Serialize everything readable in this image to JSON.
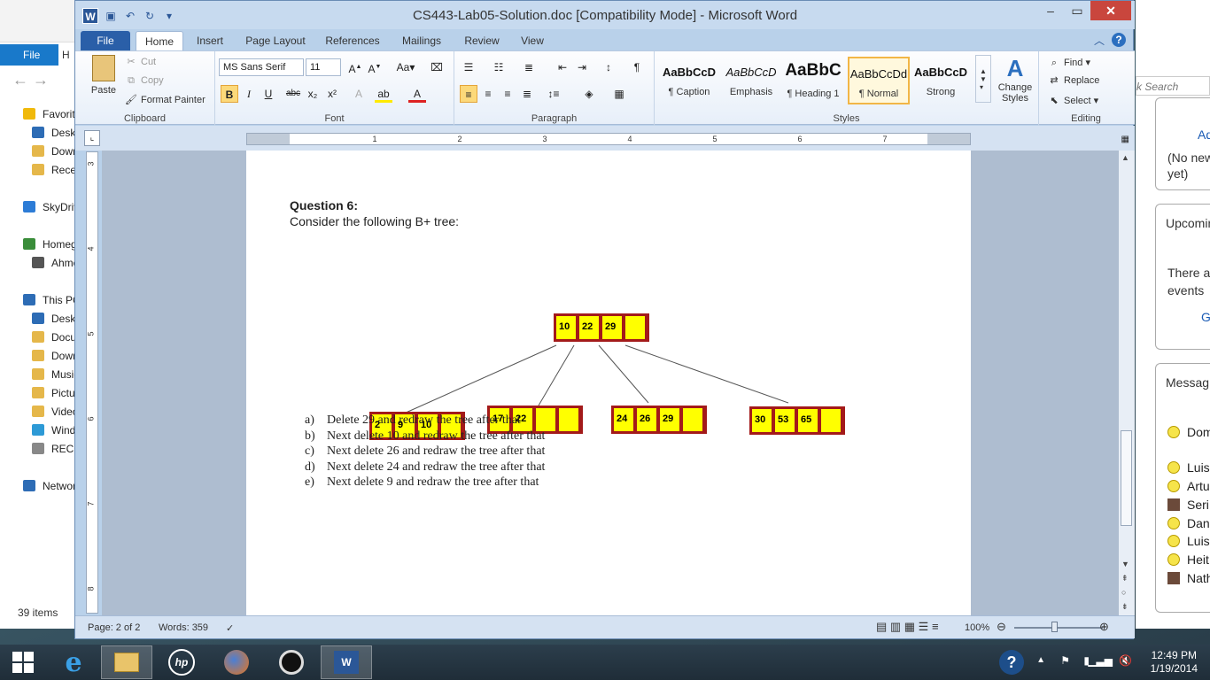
{
  "explorer": {
    "tabs": {
      "file": "File",
      "home_partial": "H"
    },
    "tree": [
      {
        "label": "Favorites",
        "color": "#f0b90b"
      },
      {
        "label": "Desktop",
        "color": "#2d6cb5"
      },
      {
        "label": "Downloads",
        "color": "#e5b74a"
      },
      {
        "label": "Recent places",
        "color": "#e5b74a"
      },
      {
        "label": "",
        "color": ""
      },
      {
        "label": "SkyDrive",
        "color": "#2d7cd6"
      },
      {
        "label": "",
        "color": ""
      },
      {
        "label": "Homegroup",
        "color": "#3a8d3a"
      },
      {
        "label": "Ahmed",
        "color": "#555"
      },
      {
        "label": "",
        "color": ""
      },
      {
        "label": "This PC",
        "color": "#2d6cb5"
      },
      {
        "label": "Desktop",
        "color": "#2d6cb5"
      },
      {
        "label": "Documents",
        "color": "#e5b74a"
      },
      {
        "label": "Downloads",
        "color": "#e5b74a"
      },
      {
        "label": "Music",
        "color": "#e5b74a"
      },
      {
        "label": "Pictures",
        "color": "#e5b74a"
      },
      {
        "label": "Videos",
        "color": "#e5b74a"
      },
      {
        "label": "Windows",
        "color": "#2d9ad6"
      },
      {
        "label": "RECOVERY",
        "color": "#888"
      },
      {
        "label": "",
        "color": ""
      },
      {
        "label": "Network",
        "color": "#2d6cb5"
      }
    ],
    "status": "39 items"
  },
  "outlook": {
    "search_placeholder": "k Search",
    "card1_link": "Ad",
    "card1_text1": "(No new",
    "card1_text2": "yet)",
    "card2_title": "Upcomin",
    "card2_text1": "There a",
    "card2_text2": "events",
    "card2_link": "G",
    "card3_title": "Messag",
    "people": [
      {
        "name": "Dom",
        "avatar": "smile"
      },
      {
        "name": "Luis",
        "avatar": "smile"
      },
      {
        "name": "Artu",
        "avatar": "smile"
      },
      {
        "name": "Seri",
        "avatar": "photo"
      },
      {
        "name": "Dan",
        "avatar": "smile"
      },
      {
        "name": "Luis",
        "avatar": "smile"
      },
      {
        "name": "Heit",
        "avatar": "smile"
      },
      {
        "name": "Nath",
        "avatar": "photo"
      }
    ]
  },
  "word": {
    "title": "CS443-Lab05-Solution.doc [Compatibility Mode]  -  Microsoft Word",
    "tabs": [
      "File",
      "Home",
      "Insert",
      "Page Layout",
      "References",
      "Mailings",
      "Review",
      "View"
    ],
    "active_tab": "Home",
    "clipboard": {
      "paste": "Paste",
      "cut": "Cut",
      "copy": "Copy",
      "format_painter": "Format Painter",
      "label": "Clipboard"
    },
    "font": {
      "name": "MS Sans Serif",
      "size": "11",
      "label": "Font"
    },
    "paragraph": {
      "label": "Paragraph"
    },
    "styles": {
      "items": [
        {
          "sample": "AaBbCcD",
          "name": "¶ Caption"
        },
        {
          "sample": "AaBbCcD",
          "name": "Emphasis"
        },
        {
          "sample": "AaBbC",
          "name": "¶ Heading 1"
        },
        {
          "sample": "AaBbCcDd",
          "name": "¶ Normal"
        },
        {
          "sample": "AaBbCcD",
          "name": "Strong"
        }
      ],
      "change_styles": "Change Styles",
      "label": "Styles"
    },
    "editing": {
      "find": "Find",
      "replace": "Replace",
      "select": "Select",
      "label": "Editing"
    },
    "ruler_ticks": [
      "1",
      "2",
      "3",
      "4",
      "5",
      "6",
      "7"
    ],
    "vruler_ticks": [
      "3",
      "4",
      "5",
      "6",
      "7",
      "8"
    ],
    "document": {
      "question_title": "Question 6:",
      "question_text": "Consider the following B+ tree:",
      "tree": {
        "root": [
          "10",
          "22",
          "29",
          ""
        ],
        "leaves": [
          [
            "2",
            "9",
            "10",
            ""
          ],
          [
            "17",
            "22",
            "",
            ""
          ],
          [
            "24",
            "26",
            "29",
            ""
          ],
          [
            "30",
            "53",
            "65",
            ""
          ]
        ]
      },
      "tasks": [
        {
          "label": "a)",
          "text": "Delete 29 and redraw the tree after that"
        },
        {
          "label": "b)",
          "text": "Next delete 10 and redraw the tree after that"
        },
        {
          "label": "c)",
          "text": "Next delete 26 and redraw the tree after that"
        },
        {
          "label": "d)",
          "text": "Next delete 24 and redraw the tree after that"
        },
        {
          "label": "e)",
          "text": "Next delete 9 and redraw the tree after that"
        }
      ]
    },
    "status": {
      "page": "Page: 2 of 2",
      "words": "Words: 359",
      "zoom": "100%"
    }
  },
  "taskbar": {
    "time": "12:49 PM",
    "date": "1/19/2014"
  }
}
